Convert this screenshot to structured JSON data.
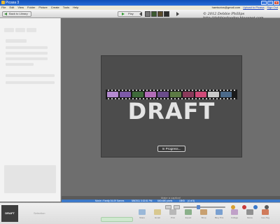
{
  "window": {
    "title": "Picasa 3",
    "min_label": "_",
    "max_label": "□",
    "close_label": "x"
  },
  "menu": [
    "File",
    "Edit",
    "View",
    "Folder",
    "Picture",
    "Create",
    "Tools",
    "Help"
  ],
  "account": {
    "email": "hamisotos@gmail.com",
    "web_albums_link": "Upload to Picasa",
    "sign_out": "Sign Out"
  },
  "toolbar": {
    "back_label": "Back to Library",
    "play_label": "Play"
  },
  "watermark": {
    "line1": "© 2012 Debbie Phillips",
    "line2": "http://debbiedoodoo.blogspot.com"
  },
  "slide": {
    "main_text": "DRAFT",
    "status_button": "In Progress..."
  },
  "caption": "Make a caption!",
  "status": {
    "left": "Movie • Family 04-09 Scenes",
    "date": "5/8/2011 3:32:51 PM",
    "dimensions": "640x480 pixels",
    "size": "15KB",
    "index": "(4 of 5)"
  },
  "tray": {
    "thumb_label": "DRAFT",
    "selection_label": "Selection",
    "labels": [
      "Share",
      "Email",
      "Print",
      "Export",
      "Shop",
      "Blog This",
      "Collage",
      "Movie",
      "Geo-Tag"
    ]
  },
  "colors": {
    "titlebar": "#1a5ccf",
    "status_bar": "#3b78c8",
    "slide_bg": "#4c4c4c",
    "canvas_bg": "#6e6e6e"
  }
}
